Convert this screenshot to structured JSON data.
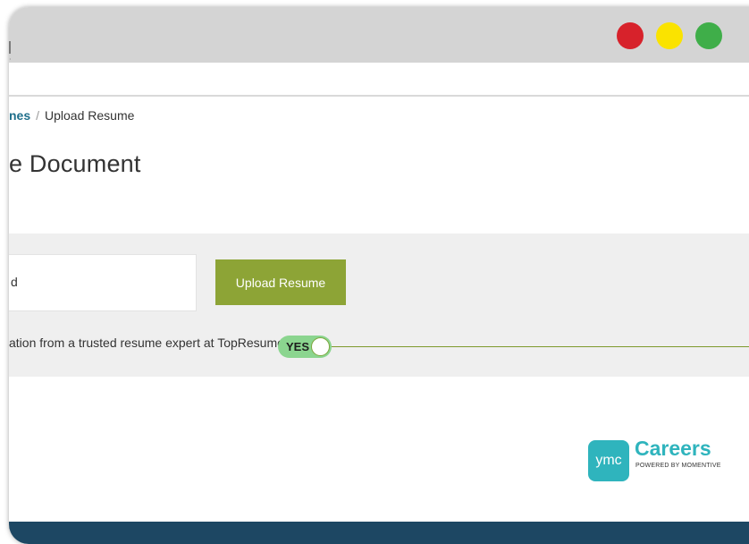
{
  "window": {
    "traffic_lights": {
      "close": "#d7222b",
      "minimize": "#fae300",
      "maximize": "#3fae49"
    },
    "titlebar_mark": ":"
  },
  "breadcrumb": {
    "link": "nes",
    "separator": "/",
    "current": "Upload Resume"
  },
  "page": {
    "title": "e Document"
  },
  "upload": {
    "file_field_value": "d",
    "button_label": "Upload Resume",
    "button_color": "#8da436"
  },
  "evaluation_option": {
    "text": "ation from a trusted resume expert at TopResume",
    "toggle_label": "YES",
    "toggle_on": true,
    "toggle_color": "#8bd58f"
  },
  "brand": {
    "logo_mark": "ymc",
    "name": "Careers",
    "tagline": "POWERED BY MOMENTIVE",
    "color": "#2fb4bd"
  },
  "colors": {
    "footer": "#1d4763",
    "link": "#1f6f8b"
  }
}
